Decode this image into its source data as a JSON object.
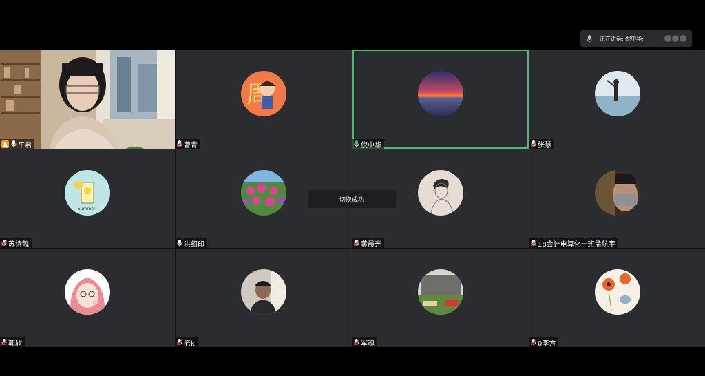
{
  "speaking": {
    "label": "正在讲话: 倪中华;"
  },
  "toast": "切换成功",
  "participants": [
    {
      "name": "平君",
      "host": true,
      "mic": "on"
    },
    {
      "name": "曹青",
      "mic": "muted"
    },
    {
      "name": "倪中华",
      "mic": "on",
      "active": true
    },
    {
      "name": "张慧",
      "mic": "muted"
    },
    {
      "name": "苏诗靓",
      "mic": "muted"
    },
    {
      "name": "洪绍印",
      "mic": "on"
    },
    {
      "name": "黄晨光",
      "mic": "muted"
    },
    {
      "name": "18会计电算化一班孟航宇",
      "mic": "muted"
    },
    {
      "name": "郭欣",
      "mic": "muted"
    },
    {
      "name": "老k",
      "mic": "muted"
    },
    {
      "name": "军魂",
      "mic": "muted"
    },
    {
      "name": "0李方",
      "mic": "muted"
    }
  ],
  "avatars": [
    "video-feed",
    "cartoon-boy-avatar",
    "sunset-avatar",
    "woman-seaside-avatar",
    "lemonade-summer-avatar",
    "flower-garden-avatar",
    "sketch-man-avatar",
    "masked-face-avatar",
    "cartoon-girl-avatar",
    "man-photo-avatar",
    "building-photo-avatar",
    "flower-bird-avatar"
  ],
  "colors": {
    "active_border": "#3ec46d",
    "host_badge": "#f39b1b",
    "tile_bg": "#2b2c2f"
  }
}
